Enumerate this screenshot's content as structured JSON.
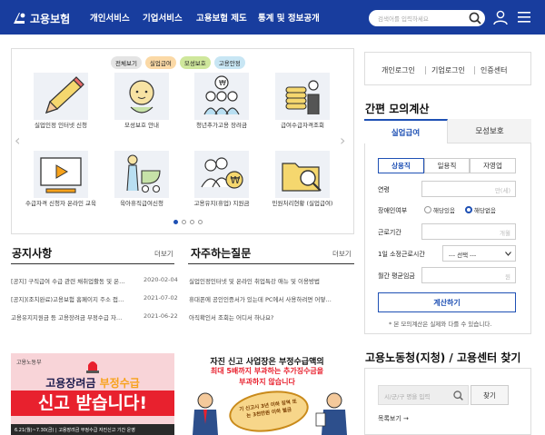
{
  "header": {
    "logo_text": "고용보험",
    "nav": [
      "개인서비스",
      "기업서비스",
      "고용보험 제도",
      "통계 및 정보공개"
    ],
    "search_placeholder": "검색어를 입력하세요",
    "icons": [
      "search-icon",
      "user-icon",
      "menu-icon"
    ]
  },
  "services": {
    "filters": [
      "전체보기",
      "실업급여",
      "모성보호",
      "고용안정"
    ],
    "filter_colors": [
      "#e4e4e4",
      "#fbd9a6",
      "#cfe79c",
      "#c8e6f4"
    ],
    "tiles": [
      {
        "label": "실업인정 인터넷 신청",
        "icon": "pencil-icon"
      },
      {
        "label": "모성보호 안내",
        "icon": "baby-icon"
      },
      {
        "label": "청년추가고용 장려금",
        "icon": "people-money-icon"
      },
      {
        "label": "급여수급자격조회",
        "icon": "coins-icon"
      },
      {
        "label": "수급자격 신청자 온라인 교육",
        "icon": "video-icon"
      },
      {
        "label": "육아휴직급여신청",
        "icon": "stroller-icon"
      },
      {
        "label": "고용유지(휴업) 지원금",
        "icon": "people-won-icon"
      },
      {
        "label": "민원처리현황 (실업급여)",
        "icon": "folder-search-icon"
      }
    ],
    "page_dots": 4,
    "active_dot": 0
  },
  "notices": {
    "title": "공지사항",
    "more": "더보기",
    "items": [
      {
        "text": "[공지] 구직급여 수급 관련 채취업활동 및 온…",
        "date": "2020-02-04"
      },
      {
        "text": "[공지](조치완료)고용보험 홈페이지 주소 접…",
        "date": "2021-07-02"
      },
      {
        "text": "고용유지지원금 등 고용장려금 부정수급 자…",
        "date": "2021-06-22"
      }
    ]
  },
  "faq": {
    "title": "자주하는질문",
    "more": "더보기",
    "items": [
      "실업인정인터넷 및 온라인 취업특강 애뉴 및 이용방법",
      "휴대폰에 공인인증서가 있는데 PC에서 사용하려면 어떻…",
      "아직확인서 조회는 어디서 하나요?"
    ]
  },
  "banners": {
    "left": {
      "org": "고용노동부",
      "line1a": "고용장려금 ",
      "line1b": "부정수급",
      "line2": "신고 받습니다!",
      "footer": "6.21(월)~7.30(금) | 고용장려금 부정수급 자진신고 기간 운영"
    },
    "right": {
      "line1": "자진 신고 사업장은 부정수급액의",
      "line2": "최대 5배까지 부과하는 추가징수금을",
      "line3": "부과하지 않습니다",
      "stamp": "기 신고시 3년 이하 징역 또는 3천만원 이하 벌금"
    }
  },
  "account": {
    "links": [
      "개인로그인",
      "기업로그인",
      "인증센터"
    ]
  },
  "calculator": {
    "title": "간편 모의계산",
    "tabs": [
      "실업급여",
      "모성보호"
    ],
    "subtabs": [
      "상용직",
      "일용직",
      "자영업"
    ],
    "fields": {
      "age": {
        "label": "연령",
        "placeholder": "만(세)"
      },
      "disability": {
        "label": "장애인여부",
        "options": [
          "해당있음",
          "해당없음"
        ],
        "selected": 1
      },
      "period": {
        "label": "근로기간",
        "placeholder": "개월"
      },
      "hours": {
        "label": "1일 소정근로시간",
        "value": "--- 선택 ---"
      },
      "wage": {
        "label": "월간 평균임금",
        "placeholder": "원"
      }
    },
    "submit": "계산하기",
    "note": "* 본 모의계산은 실제와 다를 수 있습니다."
  },
  "office": {
    "title": "고용노동청(지청) / 고용센터 찾기",
    "placeholder": "시/군/구 명을 입력",
    "button": "찾기",
    "list_link": "목록보기 →"
  },
  "colors": {
    "header": "#183d9e",
    "accent": "#1e50b4",
    "highlight": "#f7a21b",
    "alert": "#e8212e",
    "pink": "#f8d4d8"
  }
}
